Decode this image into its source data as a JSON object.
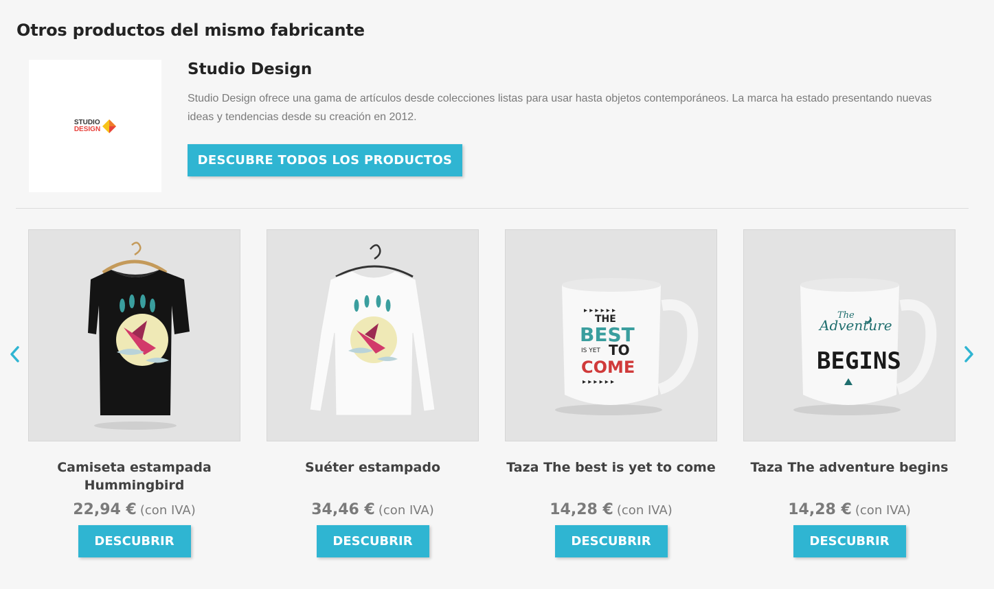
{
  "section": {
    "title": "Otros productos del mismo fabricante"
  },
  "brand": {
    "logo_line1": "STUDIO",
    "logo_line2": "DESIGN",
    "name": "Studio Design",
    "description": "Studio Design ofrece una gama de artículos desde colecciones listas para usar hasta objetos contemporáneos. La marca ha estado presentando nuevas ideas y tendencias desde su creación en 2012.",
    "button_label": "DESCUBRE TODOS LOS PRODUCTOS"
  },
  "carousel": {
    "prev_icon": "chevron-left-icon",
    "next_icon": "chevron-right-icon",
    "accent": "#2fb5d2"
  },
  "products": [
    {
      "name": "Camiseta estampada Hummingbird",
      "price": "22,94 €",
      "tax": "(con IVA)",
      "button": "DESCUBRIR",
      "image": "t-shirt-image"
    },
    {
      "name": "Suéter estampado",
      "price": "34,46 €",
      "tax": "(con IVA)",
      "button": "DESCUBRIR",
      "image": "sweater-image"
    },
    {
      "name": "Taza The best is yet to come",
      "price": "14,28 €",
      "tax": "(con IVA)",
      "button": "DESCUBRIR",
      "image": "mug-image",
      "print": [
        "THE",
        "BEST",
        "IS YET",
        "TO",
        "COME"
      ]
    },
    {
      "name": "Taza The adventure begins",
      "price": "14,28 €",
      "tax": "(con IVA)",
      "button": "DESCUBRIR",
      "image": "mug-image",
      "print": [
        "The",
        "Adventure",
        "BEGINS"
      ]
    }
  ]
}
